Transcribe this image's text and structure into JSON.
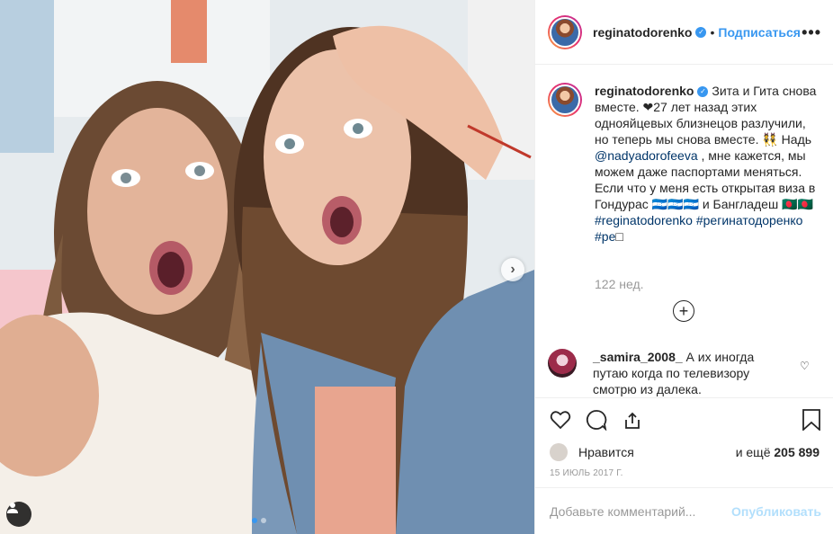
{
  "post": {
    "author": "reginatodorenko",
    "follow_label": "Подписаться",
    "more_label": "•••",
    "separator": "•"
  },
  "caption": {
    "author": "reginatodorenko",
    "part1": " Зита и Гита снова вместе. ❤27 лет назад этих однояйцевых близнецов разлучили, но теперь мы снова вместе. ",
    "emoji1": "👯",
    "part2": " Надь ",
    "mention": "@nadyadorofeeva",
    "part3": " , мне кажется, мы можем даже паспортами меняться. Если что у меня есть открытая виза в Гондурас ",
    "emoji2": "🇭🇳🇭🇳🇭🇳",
    "part4": " и Бангладеш ",
    "emoji3": "🇧🇩🇧🇩",
    "hashtags": "#reginatodorenko #регинатодоренко #ре",
    "hashtag_tail": "□",
    "time": "122 нед."
  },
  "comment": {
    "author": "_samira_2008_",
    "text": "А их иногда путаю когда по телевизору смотрю из далека."
  },
  "actions": {
    "likes_label": "Нравится",
    "likes_count_prefix": "и ещё ",
    "likes_count": "205 899",
    "date": "15 июль 2017 г."
  },
  "add_comment": {
    "placeholder": "Добавьте комментарий...",
    "publish_label": "Опубликовать"
  },
  "icons": {
    "carousel_next": "›",
    "load_more": "+",
    "comment_like": "♡"
  },
  "colors": {
    "link": "#3897f0",
    "muted": "#999999",
    "publish_disabled": "#b2dffc"
  }
}
